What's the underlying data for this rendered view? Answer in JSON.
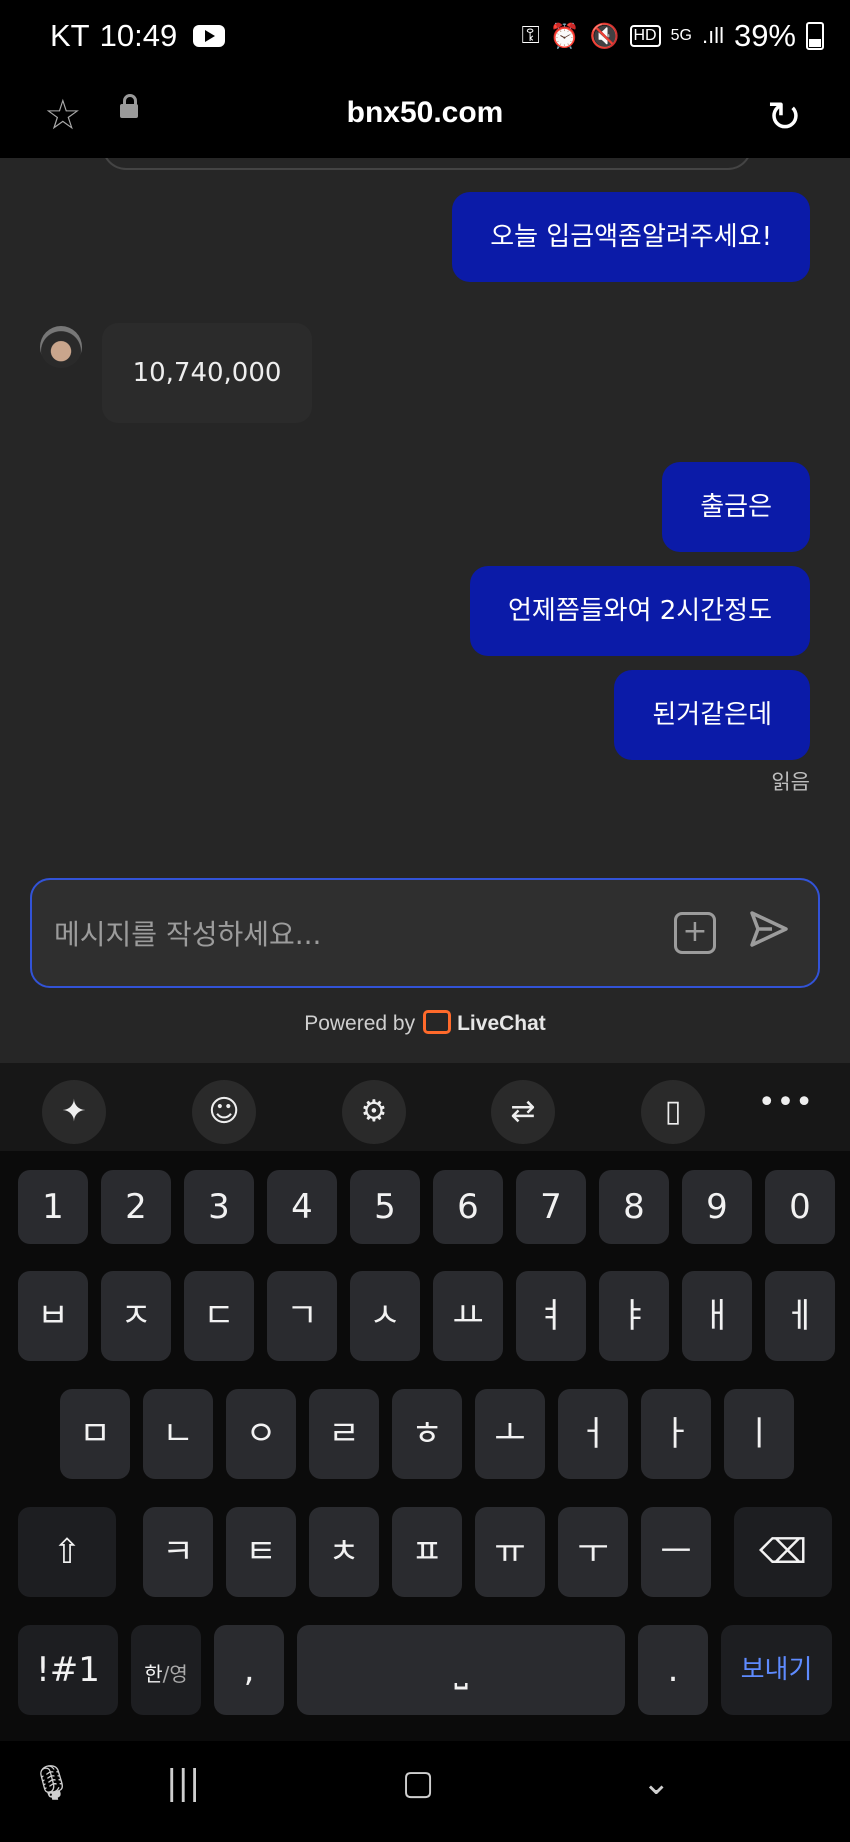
{
  "status_bar": {
    "carrier": "KT",
    "time": "10:49",
    "network": "5G",
    "signal": ".ıll",
    "battery": "39%"
  },
  "browser": {
    "url": "bnx50.com"
  },
  "chat": {
    "messages": [
      {
        "from": "me",
        "text": "오늘 입금액좀알려주세요!"
      },
      {
        "from": "agent",
        "text": "10,740,000"
      },
      {
        "from": "me",
        "text": "출금은"
      },
      {
        "from": "me",
        "text": "언제쯤들와여 2시간정도"
      },
      {
        "from": "me",
        "text": "된거같은데"
      }
    ],
    "read_receipt": "읽음",
    "input_placeholder": "메시지를 작성하세요...",
    "powered_by": "Powered by",
    "brand": "LiveChat"
  },
  "keyboard": {
    "row1": [
      "1",
      "2",
      "3",
      "4",
      "5",
      "6",
      "7",
      "8",
      "9",
      "0"
    ],
    "row2": [
      "ㅂ",
      "ㅈ",
      "ㄷ",
      "ㄱ",
      "ㅅ",
      "ㅛ",
      "ㅕ",
      "ㅑ",
      "ㅐ",
      "ㅔ"
    ],
    "row3": [
      "ㅁ",
      "ㄴ",
      "ㅇ",
      "ㄹ",
      "ㅎ",
      "ㅗ",
      "ㅓ",
      "ㅏ",
      "ㅣ"
    ],
    "row4": [
      "ㅋ",
      "ㅌ",
      "ㅊ",
      "ㅍ",
      "ㅠ",
      "ㅜ",
      "ㅡ"
    ],
    "symbols": "!#1",
    "lang_top": "한",
    "lang_bottom": "영",
    "comma": ",",
    "period": ".",
    "enter": "보내기"
  },
  "colors": {
    "bubble_me": "#0b1ba8",
    "chat_bg": "#262626",
    "input_border": "#3253d7",
    "livechat_orange": "#ff6a2b"
  }
}
